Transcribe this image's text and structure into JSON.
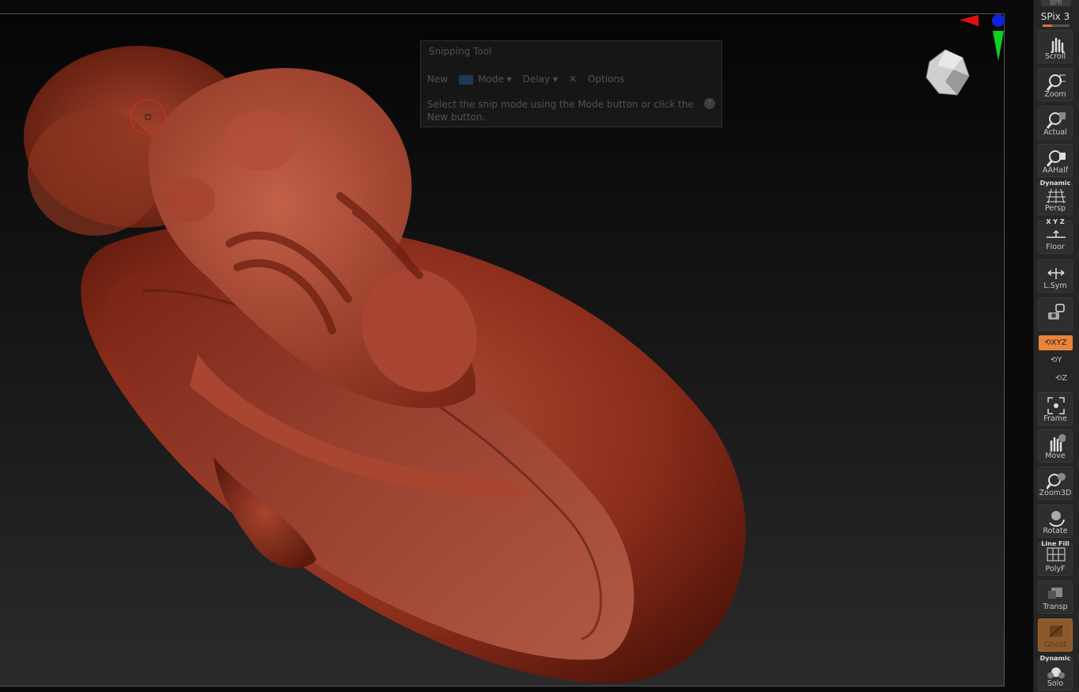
{
  "top_stub": "BPR",
  "spix": {
    "label": "SPix 3",
    "fill_fraction": 0.35
  },
  "snipping_tool": {
    "title": "Snipping Tool",
    "new_label": "New",
    "mode_label": "Mode",
    "delay_label": "Delay",
    "options_label": "Options",
    "message": "Select the snip mode using the Mode button or click the New button.",
    "help_glyph": "?"
  },
  "tools": [
    {
      "id": "scroll",
      "label": "Scroll",
      "icon": "scroll-hand-icon"
    },
    {
      "id": "zoom",
      "label": "Zoom",
      "icon": "zoom-magnifier-icon"
    },
    {
      "id": "actual",
      "label": "Actual",
      "icon": "actual-size-icon"
    },
    {
      "id": "aahalf",
      "label": "AAHalf",
      "icon": "aahalf-icon"
    },
    {
      "id": "persp",
      "label": "Persp",
      "top": "Dynamic",
      "icon": "perspective-grid-icon"
    },
    {
      "id": "floor",
      "label": "Floor",
      "top": "X Y Z",
      "icon": "floor-icon"
    },
    {
      "id": "lsym",
      "label": "L.Sym",
      "icon": "local-symmetry-icon"
    },
    {
      "id": "lock",
      "label": "",
      "icon": "camera-lock-icon"
    },
    {
      "id": "frame",
      "label": "Frame",
      "icon": "frame-icon"
    },
    {
      "id": "move",
      "label": "Move",
      "icon": "move-hand-icon"
    },
    {
      "id": "zoom3d",
      "label": "Zoom3D",
      "icon": "zoom3d-icon"
    },
    {
      "id": "rotate",
      "label": "Rotate",
      "icon": "rotate-icon"
    },
    {
      "id": "polyf",
      "label": "PolyF",
      "top": "Line Fill",
      "icon": "polyframe-grid-icon"
    },
    {
      "id": "transp",
      "label": "Transp",
      "icon": "transparency-icon"
    },
    {
      "id": "ghost",
      "label": "Ghost",
      "icon": "ghost-icon"
    },
    {
      "id": "solo",
      "label": "Solo",
      "top": "Dynamic",
      "icon": "solo-icon"
    }
  ],
  "xyz_label": "XYZ",
  "colors": {
    "model": "#8b2a1a",
    "accent": "#e8853a",
    "panel": "#262626"
  }
}
